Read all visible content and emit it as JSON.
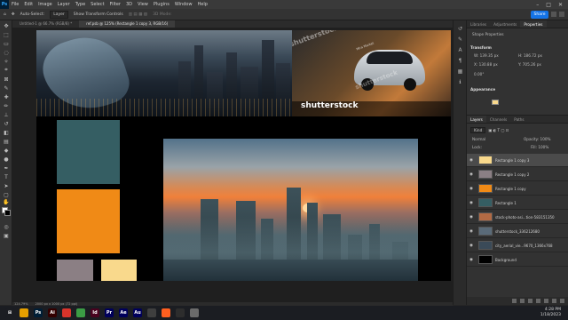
{
  "menu": {
    "app_badge": "Ps",
    "items": [
      "File",
      "Edit",
      "Image",
      "Layer",
      "Type",
      "Select",
      "Filter",
      "3D",
      "View",
      "Plugins",
      "Window",
      "Help"
    ]
  },
  "options": {
    "auto_select": "Auto-Select:",
    "auto_select_target": "Layer",
    "show_transform": "Show Transform Controls",
    "mode_3d": "3D Mode:",
    "share": "Share"
  },
  "tabs": [
    {
      "label": "Untitled-1 @ 66.7% (RGB/8) *"
    },
    {
      "label": "ref.psb @ 125% (Rectangle 1 copy 3, RGB/16)"
    }
  ],
  "canvas": {
    "watermark": "shutterstock",
    "caption_small": "Mira Market",
    "swatches": [
      {
        "name": "teal",
        "color": "#355e63"
      },
      {
        "name": "orange",
        "color": "#f08a16"
      },
      {
        "name": "gray",
        "color": "#8b7f84"
      },
      {
        "name": "cream",
        "color": "#f9d98c"
      }
    ]
  },
  "properties": {
    "tabs": [
      "Libraries",
      "Adjustments",
      "Properties"
    ],
    "shape_label": "Shape Properties",
    "transform_label": "Transform",
    "w": "W: 139.35 px",
    "h": "H: 186.72 px",
    "x": "X: 130.88 px",
    "y": "Y: 705.26 px",
    "angle": "0.00°",
    "appearance_label": "Appearance",
    "fill_color": "#f9d98c"
  },
  "layers": {
    "tabs": [
      "Layers",
      "Channels",
      "Paths"
    ],
    "kind": "Kind",
    "blend_mode": "Normal",
    "opacity": "Opacity: 100%",
    "lock": "Lock:",
    "fill": "Fill: 100%",
    "items": [
      {
        "name": "Rectangle 1 copy 3",
        "thumb": "#f9d98c",
        "selected": true
      },
      {
        "name": "Rectangle 1 copy 2",
        "thumb": "#8b7f84",
        "selected": false
      },
      {
        "name": "Rectangle 1 copy",
        "thumb": "#f08a16",
        "selected": false
      },
      {
        "name": "Rectangle 1",
        "thumb": "#355e63",
        "selected": false
      },
      {
        "name": "stock-photo-asi...tion-583151350",
        "thumb": "#b26a44",
        "selected": false
      },
      {
        "name": "shutterstock_336212680",
        "thumb": "#5a6a78",
        "selected": false
      },
      {
        "name": "city_aerial_vie...9670_1366x768",
        "thumb": "#3a4a58",
        "selected": false
      },
      {
        "name": "Background",
        "thumb": "#000000",
        "selected": false
      }
    ]
  },
  "status": {
    "zoom": "124.79%",
    "doc_size": "2000 px x 1000 px (72 ppi)"
  },
  "taskbar": {
    "time": "4:28 PM",
    "date": "1/18/2023",
    "apps": [
      {
        "badge": "⊞",
        "color": "#1b1d22"
      },
      {
        "badge": "",
        "color": "#e5a000"
      },
      {
        "badge": "Ps",
        "color": "#001e36"
      },
      {
        "badge": "Ai",
        "color": "#330000"
      },
      {
        "badge": "",
        "color": "#d9342b"
      },
      {
        "badge": "",
        "color": "#3b9c45"
      },
      {
        "badge": "Id",
        "color": "#49021f"
      },
      {
        "badge": "Pr",
        "color": "#00005b"
      },
      {
        "badge": "Ae",
        "color": "#00005b"
      },
      {
        "badge": "Au",
        "color": "#00005b"
      },
      {
        "badge": "",
        "color": "#3f3f3f"
      },
      {
        "badge": "",
        "color": "#ff5f1f"
      },
      {
        "badge": "",
        "color": "#2d2d2d"
      },
      {
        "badge": "",
        "color": "#6b6b6b"
      }
    ]
  }
}
